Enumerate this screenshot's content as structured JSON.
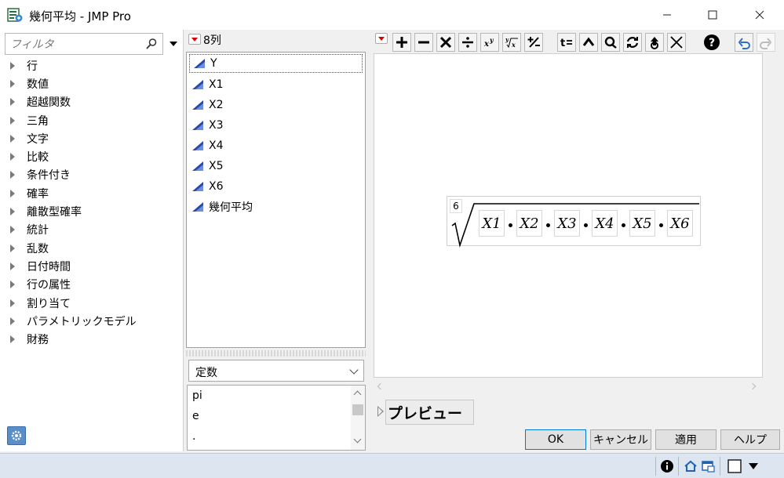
{
  "window": {
    "title": "幾何平均 - JMP Pro",
    "minimize": "—",
    "maximize": "☐",
    "close": "✕"
  },
  "filter": {
    "placeholder": "フィルタ"
  },
  "categories": [
    "行",
    "数値",
    "超越関数",
    "三角",
    "文字",
    "比較",
    "条件付き",
    "確率",
    "離散型確率",
    "統計",
    "乱数",
    "日付時間",
    "行の属性",
    "割り当て",
    "パラメトリックモデル",
    "財務"
  ],
  "columns": {
    "count_label": "8列",
    "items": [
      "Y",
      "X1",
      "X2",
      "X3",
      "X4",
      "X5",
      "X6",
      "幾何平均"
    ]
  },
  "constants": {
    "selected": "定数",
    "items": [
      "pi",
      "e",
      "."
    ]
  },
  "toolbar": {
    "buttons": [
      "plus-icon",
      "minus-icon",
      "multiply-icon",
      "divide-icon",
      "power-icon",
      "root-icon",
      "plus-minus-icon",
      "local-variable-icon",
      "peel-icon",
      "unary-icon",
      "swap-icon",
      "drop-icon",
      "delete-icon",
      "help-icon",
      "undo-icon",
      "redo-icon"
    ]
  },
  "formula": {
    "root_index": "6",
    "terms": [
      "X1",
      "X2",
      "X3",
      "X4",
      "X5",
      "X6"
    ]
  },
  "preview": {
    "label": "プレビュー"
  },
  "buttons": {
    "ok": "OK",
    "cancel": "キャンセル",
    "apply": "適用",
    "help": "ヘルプ"
  },
  "colors": {
    "accent": "#0078d7",
    "column_icon": "#2b4aa8",
    "dropdown_red": "#dd0000",
    "statusbar": "#dde6f0"
  }
}
